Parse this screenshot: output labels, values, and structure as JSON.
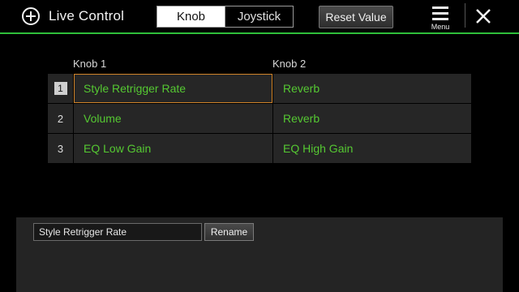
{
  "header": {
    "title": "Live Control",
    "tabs": [
      {
        "label": "Knob",
        "active": true
      },
      {
        "label": "Joystick",
        "active": false
      }
    ],
    "reset_label": "Reset Value",
    "menu_label": "Menu",
    "accent_color": "#2fbf3a"
  },
  "table": {
    "columns": [
      "Knob 1",
      "Knob 2"
    ],
    "rows": [
      {
        "num": "1",
        "knob1": "Style Retrigger Rate",
        "knob2": "Reverb"
      },
      {
        "num": "2",
        "knob1": "Volume",
        "knob2": "Reverb"
      },
      {
        "num": "3",
        "knob1": "EQ Low Gain",
        "knob2": "EQ High Gain"
      }
    ],
    "selected_row": 1,
    "value_color": "#55c832",
    "focus_color": "#d0842a"
  },
  "editor": {
    "name_value": "Style Retrigger Rate",
    "rename_label": "Rename"
  },
  "icons": {
    "app": "live-control-icon",
    "menu": "hamburger-icon",
    "close": "close-icon"
  }
}
